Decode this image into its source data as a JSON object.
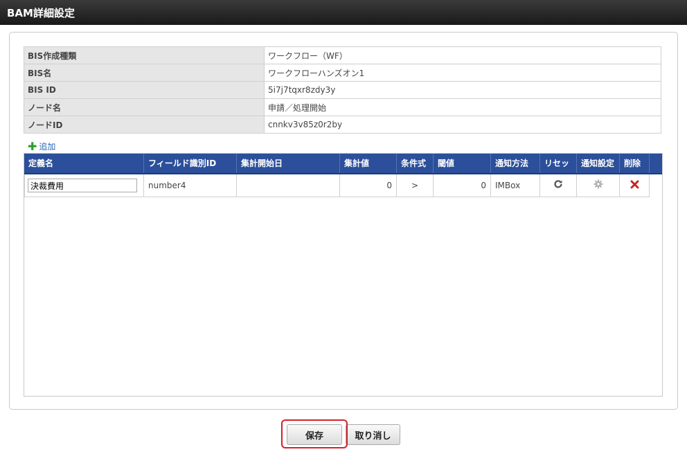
{
  "window": {
    "title": "BAM詳細設定"
  },
  "info": [
    {
      "label": "BIS作成種類",
      "value": "ワークフロー（WF）"
    },
    {
      "label": "BIS名",
      "value": "ワークフローハンズオン1"
    },
    {
      "label": "BIS ID",
      "value": "5i7j7tqxr8zdy3y"
    },
    {
      "label": "ノード名",
      "value": "申請／処理開始"
    },
    {
      "label": "ノードID",
      "value": "cnnkv3v85z0r2by"
    }
  ],
  "add_label": "追加",
  "grid": {
    "headers": [
      "定義名",
      "フィールド識別ID",
      "集計開始日",
      "集計値",
      "条件式",
      "閾値",
      "通知方法",
      "リセット",
      "通知設定",
      "削除"
    ],
    "rows": [
      {
        "name": "決裁費用",
        "field_id": "number4",
        "start_date": "",
        "value": "0",
        "condition": ">",
        "threshold": "0",
        "notify_method": "IMBox"
      }
    ]
  },
  "buttons": {
    "save": "保存",
    "cancel": "取り消し"
  },
  "colors": {
    "header_bg": "#2b4f9a",
    "highlight": "#d2212a",
    "delete": "#cc2222"
  },
  "icons": {
    "reset": "refresh-icon",
    "notify": "gear-icon",
    "delete": "delete-x-icon",
    "add": "plus-icon"
  }
}
